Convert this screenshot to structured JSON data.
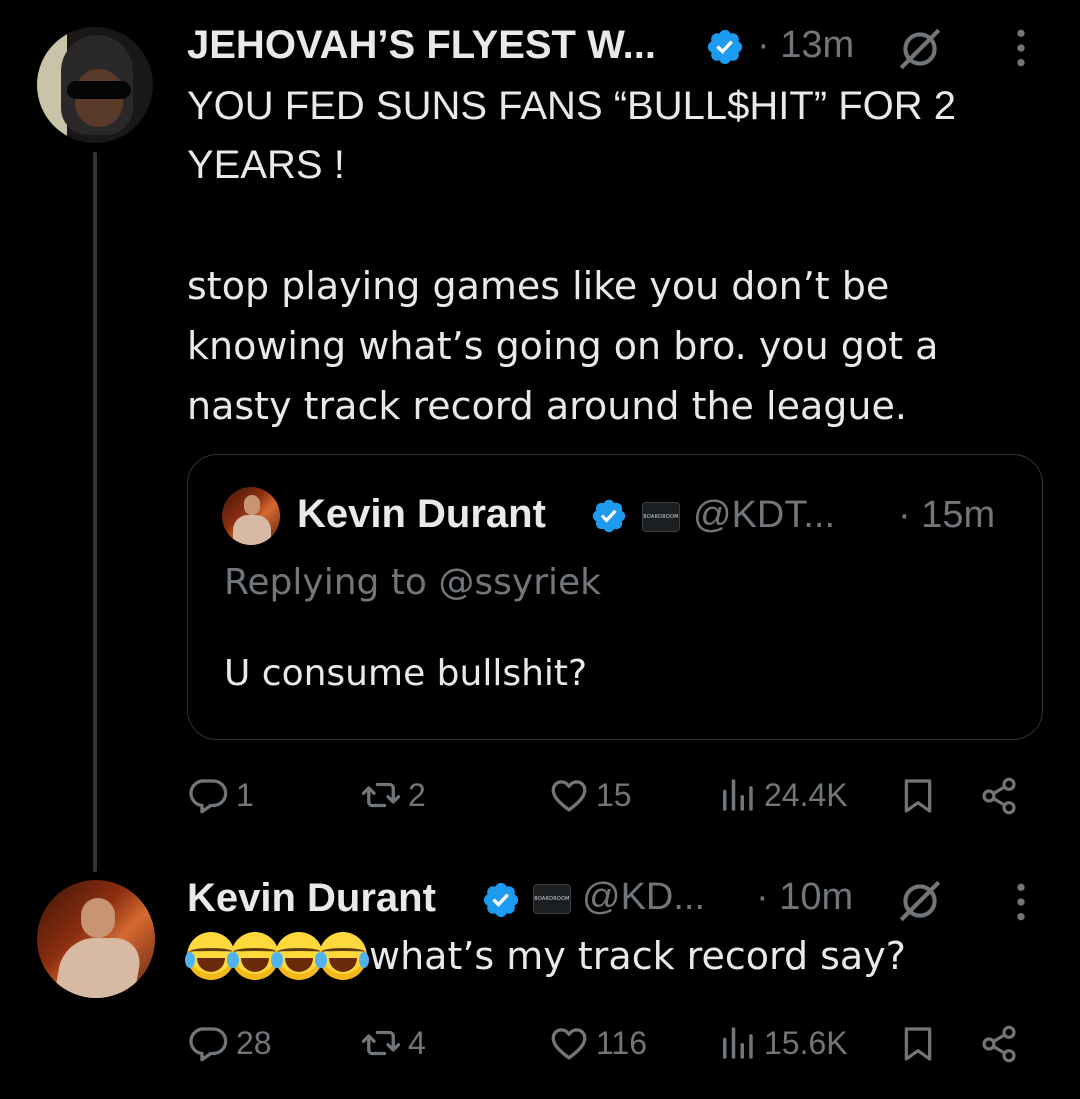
{
  "tweet1": {
    "display_name": "JEHOVAH’S FLYEST W...",
    "time": "· 13m",
    "text_line1": "YOU FED SUNS FANS “BULL$HIT” FOR 2",
    "text_line2": "YEARS !",
    "text_para2_line1": "stop playing games like you don’t be",
    "text_para2_line2": "knowing what’s going on bro. you got a",
    "text_para2_line3": "nasty track record around the league.",
    "stats": {
      "replies": "1",
      "retweets": "2",
      "likes": "15",
      "views": "24.4K"
    }
  },
  "quoted": {
    "display_name": "Kevin Durant",
    "handle": "@KDT...",
    "time": "· 15m",
    "replying_to": "Replying to @ssyriek",
    "text": "U consume bullshit?",
    "org_badge": "BOARDROOM"
  },
  "tweet2": {
    "display_name": "Kevin Durant",
    "handle": "@KD...",
    "time": "· 10m",
    "text": "what’s my track record say?",
    "org_badge": "BOARDROOM",
    "stats": {
      "replies": "28",
      "retweets": "4",
      "likes": "116",
      "views": "15.6K"
    }
  },
  "colors": {
    "background": "#000000",
    "text": "#e7e9ea",
    "muted": "#71767b",
    "verified": "#1d9bf0",
    "border": "#2f3336"
  },
  "icons": [
    "more-icon",
    "grok-slash-icon",
    "verified-badge-icon",
    "reply-icon",
    "retweet-icon",
    "like-icon",
    "views-icon",
    "bookmark-icon",
    "share-icon",
    "laughing-emoji-icon"
  ]
}
